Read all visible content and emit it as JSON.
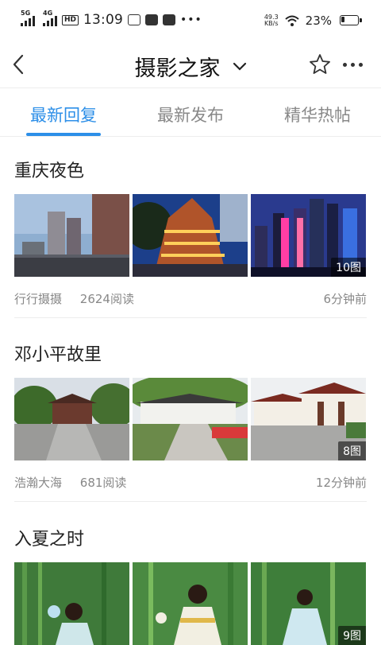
{
  "status_bar": {
    "net1": "5G",
    "net2": "4G",
    "hd": "HD",
    "time": "13:09",
    "speed_value": "49.3",
    "speed_unit": "KB/s",
    "battery": "23%",
    "battery_level": 0.23
  },
  "header": {
    "title": "摄影之家"
  },
  "tabs": [
    {
      "label": "最新回复",
      "active": true
    },
    {
      "label": "最新发布",
      "active": false
    },
    {
      "label": "精华热帖",
      "active": false
    }
  ],
  "posts": [
    {
      "title": "重庆夜色",
      "author": "行行摄摄",
      "reads": "2624阅读",
      "time": "6分钟前",
      "image_count": "10图"
    },
    {
      "title": "邓小平故里",
      "author": "浩瀚大海",
      "reads": "681阅读",
      "time": "12分钟前",
      "image_count": "8图"
    },
    {
      "title": "入夏之时",
      "author": "",
      "reads": "",
      "time": "",
      "image_count": "9图"
    }
  ],
  "colors": {
    "accent": "#2d8fe8",
    "muted_text": "#888888"
  }
}
